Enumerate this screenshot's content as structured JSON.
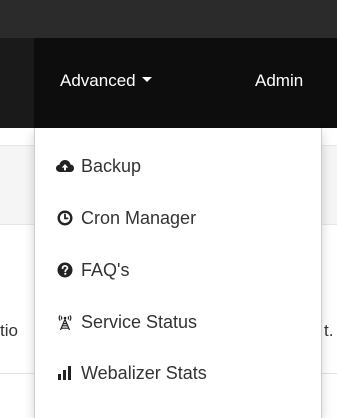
{
  "navbar": {
    "items": [
      {
        "label": "Advanced"
      },
      {
        "label": "Admin"
      }
    ]
  },
  "background": {
    "left_fragment": "tio",
    "right_fragment": "t."
  },
  "dropdown": {
    "items": [
      {
        "label": "Backup",
        "icon": "cloud-upload-icon"
      },
      {
        "label": "Cron Manager",
        "icon": "clock-icon"
      },
      {
        "label": "FAQ's",
        "icon": "question-circle-icon"
      },
      {
        "label": "Service Status",
        "icon": "broadcast-tower-icon"
      },
      {
        "label": "Webalizer Stats",
        "icon": "signal-bars-icon"
      }
    ]
  },
  "colors": {
    "navbar_bg": "#0d0d0d",
    "topstrip_bg": "#2b2b2b",
    "menu_text": "#333333",
    "icon_color": "#222222"
  }
}
